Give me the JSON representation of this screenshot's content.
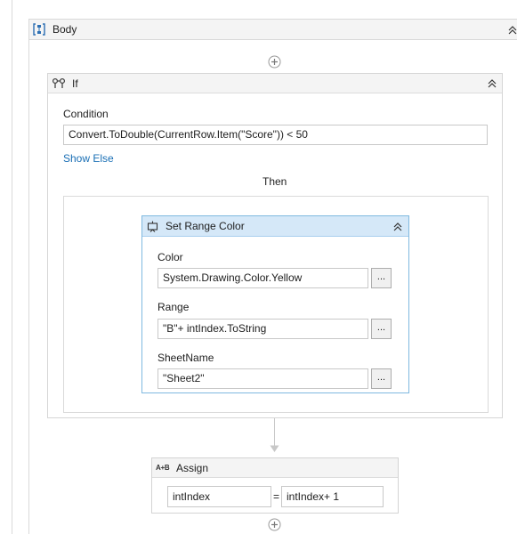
{
  "body": {
    "title": "Body"
  },
  "if_activity": {
    "title": "If",
    "condition_label": "Condition",
    "condition_value": "Convert.ToDouble(CurrentRow.Item(\"Score\")) < 50",
    "show_else": "Show Else",
    "then_label": "Then"
  },
  "set_range_color": {
    "title": "Set Range Color",
    "color_label": "Color",
    "color_value": "System.Drawing.Color.Yellow",
    "range_label": "Range",
    "range_value": "\"B\"+ intIndex.ToString",
    "sheet_label": "SheetName",
    "sheet_value": "\"Sheet2\"",
    "browse_label": "..."
  },
  "assign": {
    "icon_text": "A+B",
    "title": "Assign",
    "to_value": "intIndex",
    "equals": "=",
    "value": "intIndex+ 1"
  },
  "colors": {
    "accent_header": "#d5e8f8",
    "accent_border": "#7fb9e0",
    "link": "#1a6fb5"
  }
}
